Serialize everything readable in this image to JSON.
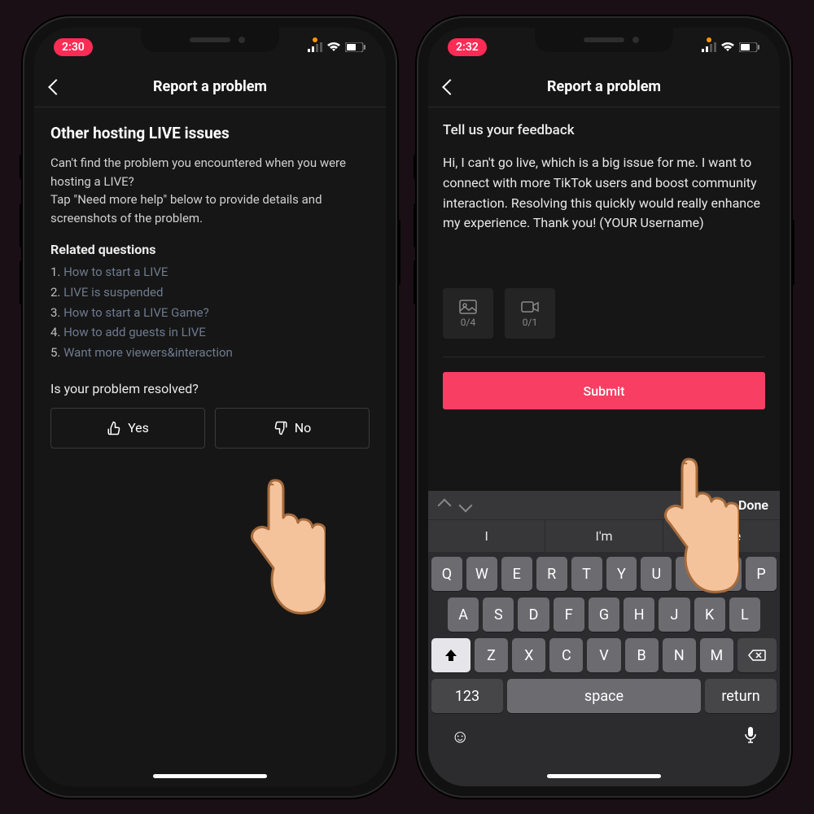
{
  "left": {
    "status_time": "2:30",
    "nav_title": "Report a problem",
    "section_title": "Other hosting LIVE issues",
    "body_p1": "Can't find the problem you encountered when you were hosting a LIVE?",
    "body_p2": "Tap \"Need more help\" below to provide details and screenshots of the problem.",
    "related_title": "Related questions",
    "related": [
      "How to start a LIVE",
      "LIVE is suspended",
      "How to start a LIVE Game?",
      "How to add guests in LIVE",
      "Want more viewers&interaction"
    ],
    "resolved_q": "Is your problem resolved?",
    "yes_label": "Yes",
    "no_label": "No"
  },
  "right": {
    "status_time": "2:32",
    "nav_title": "Report a problem",
    "feedback_title": "Tell us your feedback",
    "feedback_text": "Hi, I can't go live, which is a big issue for me. I want to connect with more TikTok users and boost community interaction. Resolving this quickly would really enhance my experience. Thank you! (YOUR Username)",
    "photo_count": "0/4",
    "video_count": "0/1",
    "submit_label": "Submit",
    "kbd_done": "Done",
    "suggestions": [
      "I",
      "I'm",
      "Please"
    ],
    "row1": [
      "Q",
      "W",
      "E",
      "R",
      "T",
      "Y",
      "U",
      "I",
      "O",
      "P"
    ],
    "row2": [
      "A",
      "S",
      "D",
      "F",
      "G",
      "H",
      "J",
      "K",
      "L"
    ],
    "row3": [
      "Z",
      "X",
      "C",
      "V",
      "B",
      "N",
      "M"
    ],
    "key_123": "123",
    "key_space": "space",
    "key_return": "return"
  }
}
